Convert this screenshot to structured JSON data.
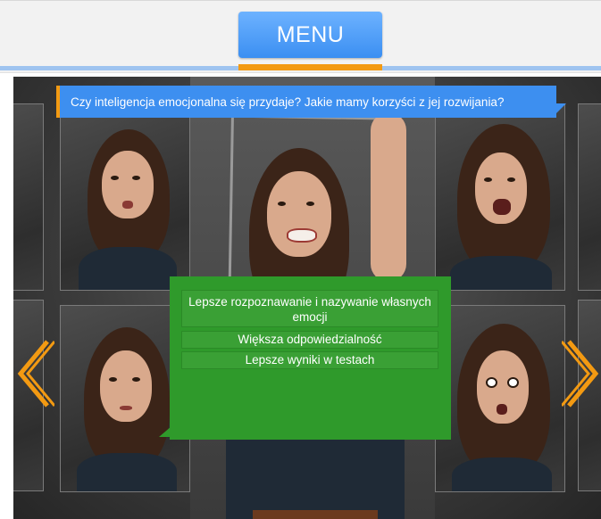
{
  "header": {
    "menu_label": "MENU"
  },
  "question": {
    "text": "Czy inteligencja emocjonalna się przydaje? Jakie mamy korzyści z jej rozwijania?"
  },
  "answers": [
    {
      "label": "Lepsze rozpoznawanie i nazywanie własnych emocji"
    },
    {
      "label": "Większa odpowiedzialność"
    },
    {
      "label": "Lepsze wyniki w testach"
    }
  ],
  "colors": {
    "menu_blue": "#4a9cf7",
    "accent_orange": "#f39a12",
    "question_blue": "#3d8ff0",
    "answer_green": "#2f9a2b"
  },
  "icons": {
    "prev": "chevron-left-icon",
    "next": "chevron-right-icon"
  }
}
